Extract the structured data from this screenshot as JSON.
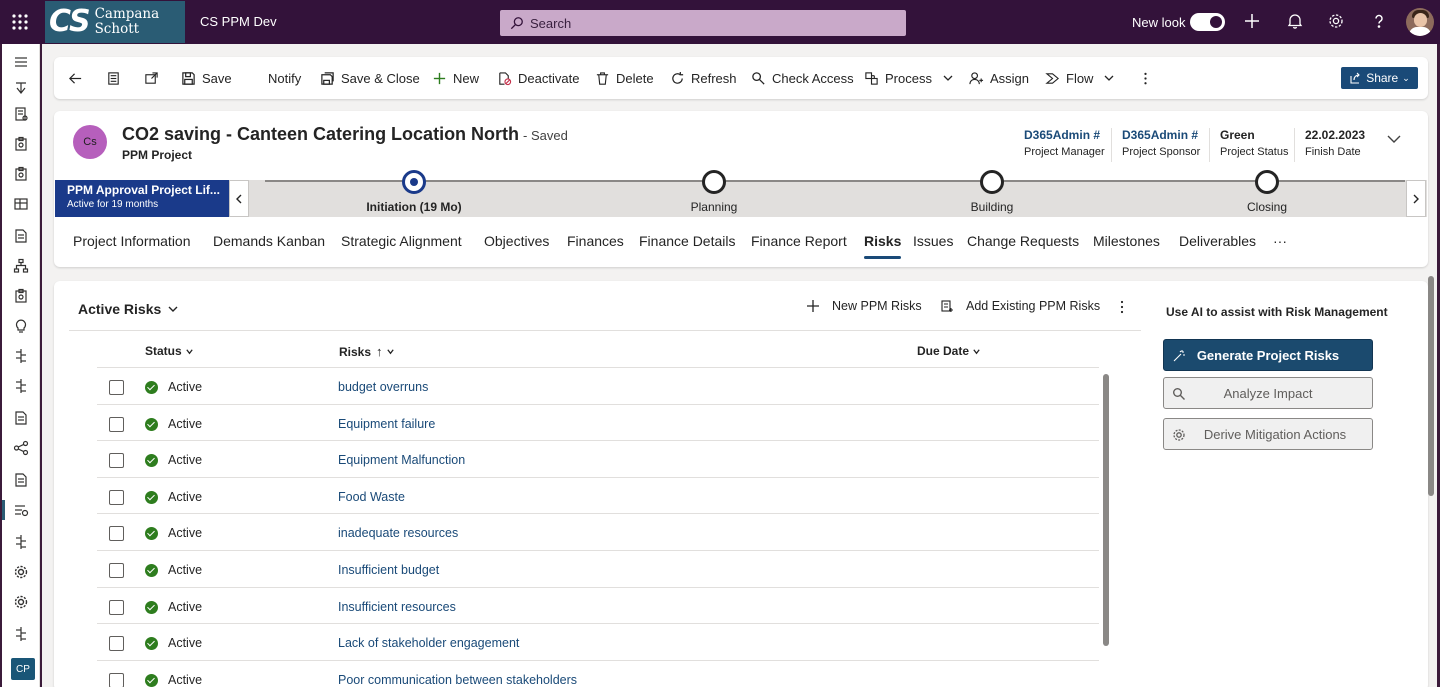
{
  "topbar": {
    "logo_mark": "CS",
    "logo_line1": "Campana",
    "logo_line2": "Schott",
    "app_name": "CS PPM Dev",
    "search_placeholder": "Search",
    "new_look_label": "New look"
  },
  "leftnav": {
    "bottom_badge": "CP"
  },
  "commandbar": {
    "save": "Save",
    "notify": "Notify",
    "save_close": "Save & Close",
    "new": "New",
    "deactivate": "Deactivate",
    "delete": "Delete",
    "refresh": "Refresh",
    "check_access": "Check Access",
    "process": "Process",
    "assign": "Assign",
    "flow": "Flow",
    "share": "Share"
  },
  "record": {
    "initials": "Cs",
    "title": "CO2 saving - Canteen Catering Location North",
    "saved": "- Saved",
    "entity": "PPM Project",
    "fields": [
      {
        "value": "D365Admin #",
        "label": "Project Manager"
      },
      {
        "value": "D365Admin #",
        "label": "Project Sponsor"
      },
      {
        "value": "Green",
        "label": "Project Status"
      },
      {
        "value": "22.02.2023",
        "label": "Finish Date"
      }
    ]
  },
  "process": {
    "name": "PPM Approval Project Lif...",
    "active_for": "Active for 19 months",
    "stages": [
      {
        "name": "Initiation  (19 Mo)",
        "active": true
      },
      {
        "name": "Planning",
        "active": false
      },
      {
        "name": "Building",
        "active": false
      },
      {
        "name": "Closing",
        "active": false
      }
    ]
  },
  "tabs": [
    "Project Information",
    "Demands Kanban",
    "Strategic Alignment",
    "Objectives",
    "Finances",
    "Finance Details",
    "Finance Report",
    "Risks",
    "Issues",
    "Change Requests",
    "Milestones",
    "Deliverables",
    "···"
  ],
  "grid": {
    "view_name": "Active Risks",
    "new_button": "New PPM Risks",
    "add_existing_button": "Add Existing PPM Risks",
    "columns": {
      "status": "Status",
      "risks": "Risks",
      "due_date": "Due Date"
    },
    "rows": [
      {
        "status": "Active",
        "risk": "budget overruns"
      },
      {
        "status": "Active",
        "risk": "Equipment failure"
      },
      {
        "status": "Active",
        "risk": "Equipment Malfunction"
      },
      {
        "status": "Active",
        "risk": "Food Waste"
      },
      {
        "status": "Active",
        "risk": "inadequate resources"
      },
      {
        "status": "Active",
        "risk": "Insufficient budget"
      },
      {
        "status": "Active",
        "risk": "Insufficient resources"
      },
      {
        "status": "Active",
        "risk": "Lack of stakeholder engagement"
      },
      {
        "status": "Active",
        "risk": "Poor communication between stakeholders"
      }
    ]
  },
  "ai_panel": {
    "title": "Use AI to assist with Risk Management",
    "generate": "Generate Project Risks",
    "analyze": "Analyze Impact",
    "derive": "Derive Mitigation Actions"
  },
  "colors": {
    "topbar": "#33123a",
    "logo_bg": "#2a5c74",
    "process_flag": "#1a3a8a",
    "primary_button": "#1b4a6e",
    "link": "#1a4a78",
    "status_active": "#2e7d1e"
  }
}
